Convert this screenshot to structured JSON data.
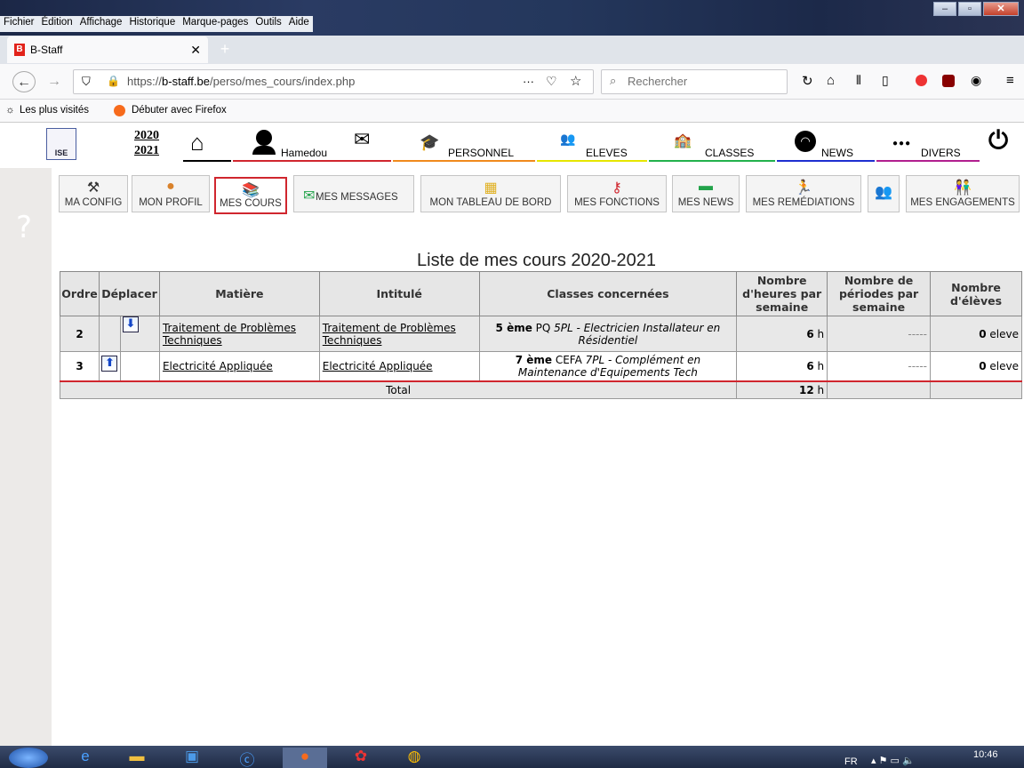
{
  "browser": {
    "menu": [
      "Fichier",
      "Édition",
      "Affichage",
      "Historique",
      "Marque-pages",
      "Outils",
      "Aide"
    ],
    "tab_title": "B-Staff",
    "tab_favicon": "B",
    "url_prefix": "https://",
    "url_domain": "b-staff.be",
    "url_path": "/perso/mes_cours/index.php",
    "search_placeholder": "Rechercher",
    "bookmarks": [
      "Les plus visités",
      "Débuter avec Firefox"
    ]
  },
  "app": {
    "year_top": "2020",
    "year_bottom": "2021",
    "user": "Hamedou",
    "nav": [
      "PERSONNEL",
      "ELEVES",
      "CLASSES",
      "NEWS",
      "DIVERS"
    ],
    "nav_colors": [
      "#f08a1c",
      "#e6e600",
      "#22b14c",
      "#1e2fd0",
      "#b11f8f"
    ],
    "logo_text": "ISE",
    "help": "?",
    "subtabs": [
      {
        "label": "MA CONFIG",
        "icon": "tools-icon"
      },
      {
        "label": "MON PROFIL",
        "icon": "person-icon"
      },
      {
        "label": "MES COURS",
        "icon": "books-icon"
      },
      {
        "label": "MES MESSAGES",
        "icon": "envelope-icon"
      },
      {
        "label": "MON TABLEAU DE BORD",
        "icon": "board-icon"
      },
      {
        "label": "MES FONCTIONS",
        "icon": "key-icon"
      },
      {
        "label": "MES NEWS",
        "icon": "chat-icon"
      },
      {
        "label": "MES REMÉDIATIONS",
        "icon": "runner-icon"
      },
      {
        "label": "",
        "icon": "group-icon"
      },
      {
        "label": "MES ENGAGEMENTS",
        "icon": "people-icon"
      }
    ]
  },
  "courses": {
    "title": "Liste de mes cours 2020-2021",
    "headers": [
      "Ordre",
      "Déplacer",
      "Matière",
      "Intitulé",
      "Classes concernées",
      "Nombre d'heures par semaine",
      "Nombre de périodes par semaine",
      "Nombre d'élèves"
    ],
    "rows": [
      {
        "ordre": "2",
        "matiere": "Traitement de Problèmes Techniques",
        "intitule": "Traitement de Problèmes Techniques",
        "classe_bold": "5 ème",
        "classe_pq": " PQ ",
        "classe_it": "5PL - Electricien Installateur en Résidentiel",
        "heures": "6",
        "h": " h",
        "periodes": "-----",
        "eleves": "0",
        "eleves_unit": " eleve",
        "arrow": "down"
      },
      {
        "ordre": "3",
        "matiere": "Electricité Appliquée",
        "intitule": "Electricité Appliquée",
        "classe_bold": "7 ème",
        "classe_pq": " CEFA ",
        "classe_it": "7PL - Complément en Maintenance d'Equipements Tech",
        "heures": "6",
        "h": " h",
        "periodes": "-----",
        "eleves": "0",
        "eleves_unit": " eleve",
        "arrow": "up"
      }
    ],
    "total_label": "Total",
    "total_heures": "12",
    "total_h": " h"
  },
  "taskbar": {
    "lang": "FR",
    "time": "10:46"
  }
}
